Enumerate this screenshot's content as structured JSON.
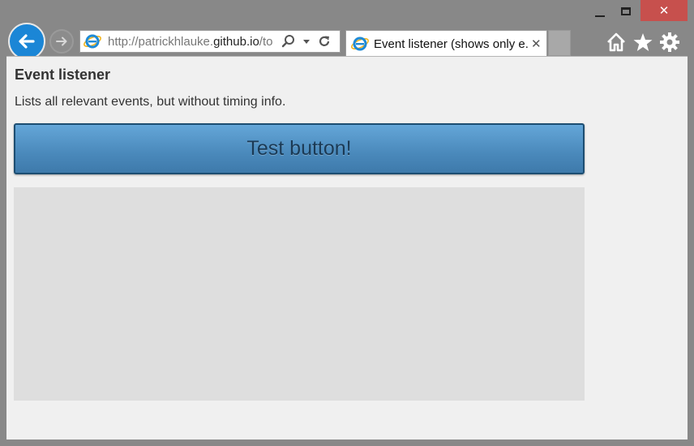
{
  "window": {
    "close_label": "✕"
  },
  "nav": {
    "address_prefix": "http://patrickhlauke.",
    "address_domain": "github.io",
    "address_suffix": "/to",
    "search_icon": "search-icon",
    "dropdown_icon": "chevron-down-icon",
    "refresh_icon": "refresh-icon"
  },
  "tab": {
    "title": "Event listener (shows only e...",
    "close_label": "✕"
  },
  "toolbar": {
    "icons": [
      "home-icon",
      "star-icon",
      "gear-icon"
    ]
  },
  "page": {
    "title": "Event listener",
    "description": "Lists all relevant events, but without timing info.",
    "button_label": "Test button!"
  },
  "colors": {
    "accent": "#1b86d6",
    "button": "#4a89bb",
    "close": "#c7504d"
  }
}
